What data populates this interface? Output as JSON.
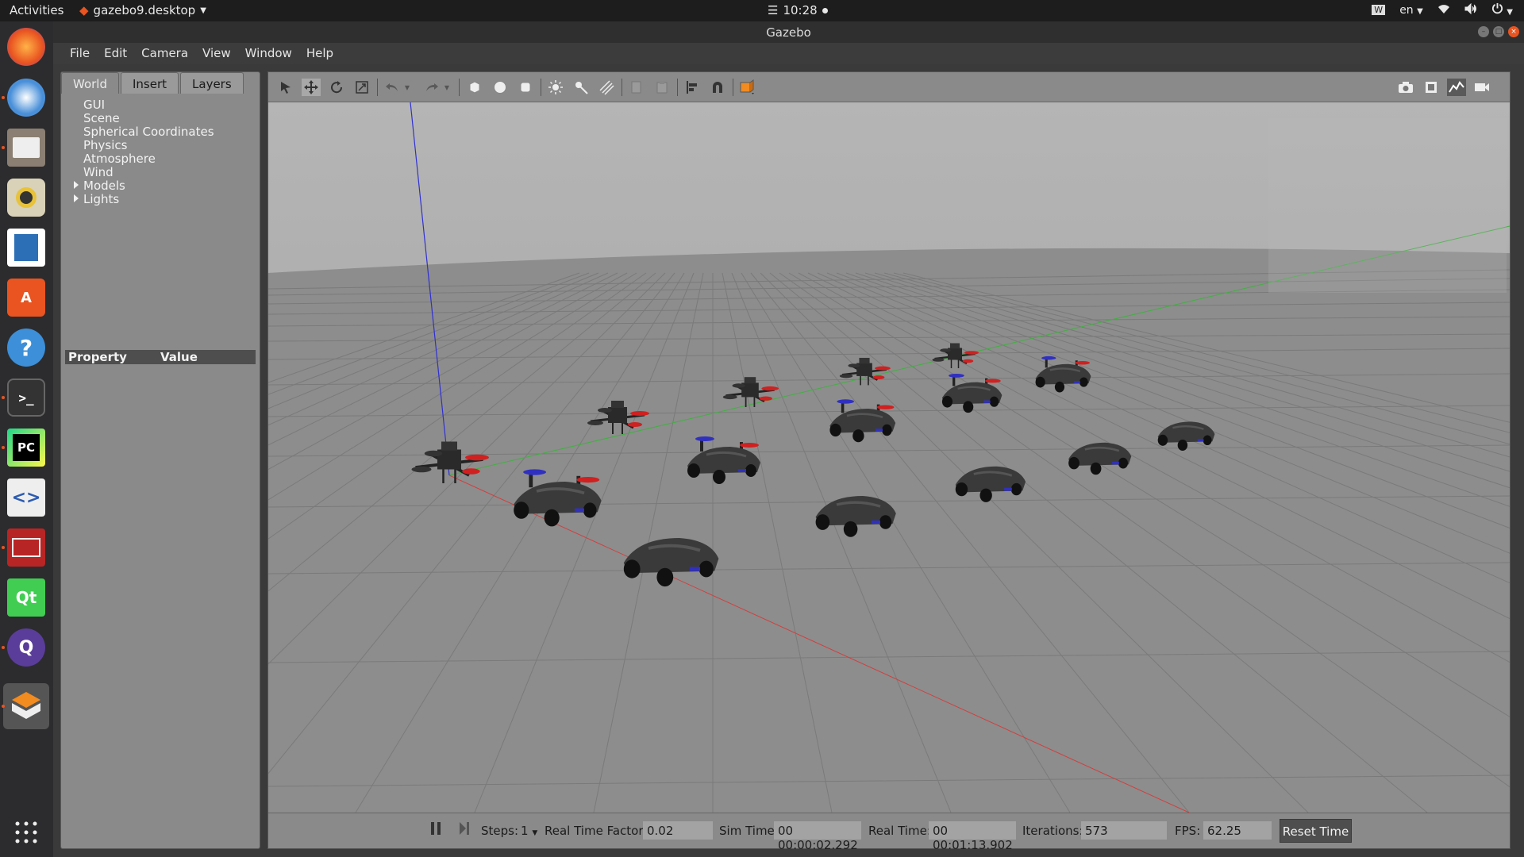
{
  "topbar": {
    "activities": "Activities",
    "app_name": "gazebo9.desktop",
    "clock": "10:28",
    "lang": "en"
  },
  "window": {
    "title": "Gazebo"
  },
  "menu": [
    "File",
    "Edit",
    "Camera",
    "View",
    "Window",
    "Help"
  ],
  "left_panel": {
    "tabs": [
      "World",
      "Insert",
      "Layers"
    ],
    "active_tab": "World",
    "tree": [
      {
        "label": "GUI",
        "expandable": false
      },
      {
        "label": "Scene",
        "expandable": false
      },
      {
        "label": "Spherical Coordinates",
        "expandable": false
      },
      {
        "label": "Physics",
        "expandable": false
      },
      {
        "label": "Atmosphere",
        "expandable": false
      },
      {
        "label": "Wind",
        "expandable": false
      },
      {
        "label": "Models",
        "expandable": true
      },
      {
        "label": "Lights",
        "expandable": true
      }
    ],
    "property_header": {
      "property": "Property",
      "value": "Value"
    }
  },
  "bottom_bar": {
    "steps_label": "Steps:",
    "steps_value": "1",
    "rtf_label": "Real Time Factor:",
    "rtf_value": "0.02",
    "sim_time_label": "Sim Time:",
    "sim_time_value": "00 00:00:02.292",
    "real_time_label": "Real Time:",
    "real_time_value": "00 00:01:13.902",
    "iterations_label": "Iterations:",
    "iterations_value": "573",
    "fps_label": "FPS:",
    "fps_value": "62.25",
    "reset_label": "Reset Time"
  },
  "colors": {
    "accent": "#e95420",
    "scene_sky": "#9c9c9c",
    "scene_ground": "#8e8e8e",
    "axis_x": "#d04040",
    "axis_y": "#40b040",
    "axis_z": "#3030d0"
  },
  "icons": {
    "dock": [
      "firefox-icon",
      "thunderbird-icon",
      "files-icon",
      "rhythmbox-icon",
      "writer-icon",
      "software-icon",
      "help-icon",
      "terminal-icon",
      "pycharm-icon",
      "code-icon",
      "red-app-icon",
      "qt-icon",
      "qgroundcontrol-icon",
      "gazebo-icon",
      "app-grid-icon"
    ]
  }
}
